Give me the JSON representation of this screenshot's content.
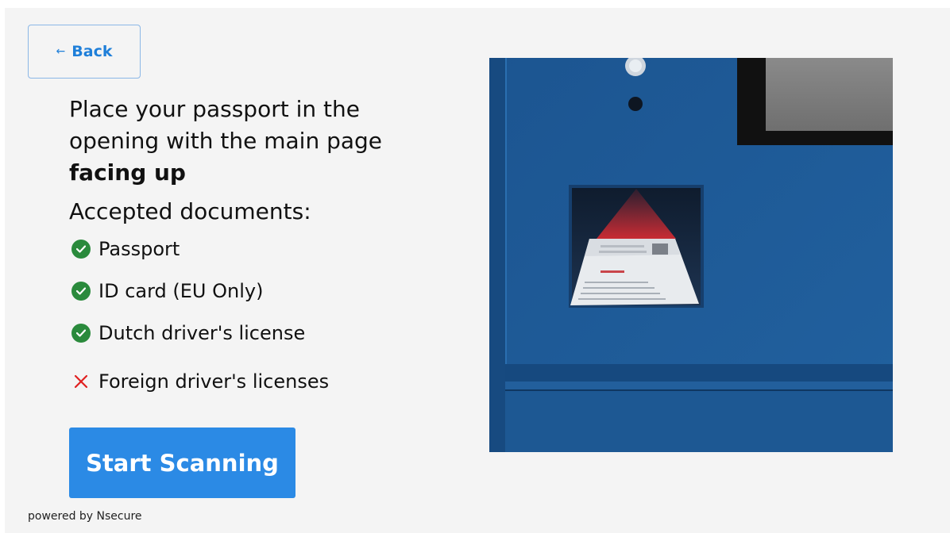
{
  "back_button": {
    "label": "Back"
  },
  "instruction": {
    "text": "Place your passport in the opening with the main page ",
    "emphasis": "facing up"
  },
  "accepted": {
    "title": "Accepted documents:",
    "items": [
      {
        "label": "Passport",
        "status": "accepted",
        "icon": "check-circle-icon"
      },
      {
        "label": "ID card (EU Only)",
        "status": "accepted",
        "icon": "check-circle-icon"
      },
      {
        "label": "Dutch driver's license",
        "status": "accepted",
        "icon": "check-circle-icon"
      },
      {
        "label": "Foreign driver's licenses",
        "status": "rejected",
        "icon": "cross-icon"
      }
    ]
  },
  "start_button": {
    "label": "Start Scanning"
  },
  "footer": {
    "powered_by": "powered by Nsecure"
  },
  "colors": {
    "accent": "#2b8ae5",
    "back_text": "#1f7fd9",
    "check_green": "#2a8a3c",
    "cross_red": "#e02020",
    "kiosk_blue": "#1f5c98",
    "background": "#f4f4f4"
  }
}
